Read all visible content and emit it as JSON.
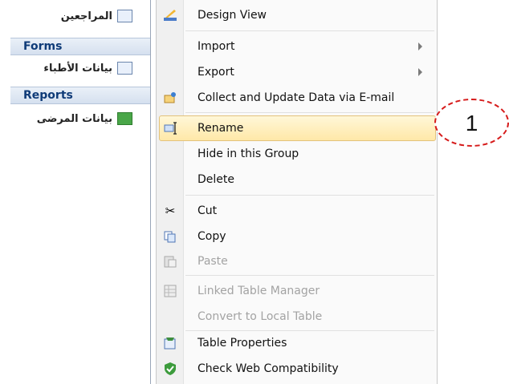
{
  "nav": {
    "top_item": "المراجعين",
    "forms_header": "Forms",
    "forms_item": "بيانات الأطباء",
    "reports_header": "Reports",
    "reports_item": "بيانات المرضى"
  },
  "menu": {
    "items": [
      {
        "label": "Design View",
        "icon": "design-view-icon",
        "disabled": false
      },
      {
        "label": "Import",
        "icon": "",
        "submenu": true,
        "disabled": false
      },
      {
        "label": "Export",
        "icon": "",
        "submenu": true,
        "disabled": false
      },
      {
        "label": "Collect and Update Data via E-mail",
        "icon": "collect-data-icon",
        "disabled": false
      },
      {
        "label": "Rename",
        "icon": "rename-icon",
        "disabled": false,
        "highlighted": true
      },
      {
        "label": "Hide in this Group",
        "icon": "",
        "disabled": false
      },
      {
        "label": "Delete",
        "icon": "",
        "disabled": false
      },
      {
        "label": "Cut",
        "icon": "scissors-icon",
        "disabled": false
      },
      {
        "label": "Copy",
        "icon": "copy-icon",
        "disabled": false
      },
      {
        "label": "Paste",
        "icon": "paste-icon",
        "disabled": true
      },
      {
        "label": "Linked Table Manager",
        "icon": "linked-table-icon",
        "disabled": true
      },
      {
        "label": "Convert to Local Table",
        "icon": "",
        "disabled": true
      },
      {
        "label": "Table Properties",
        "icon": "table-properties-icon",
        "disabled": false
      },
      {
        "label": "Check Web Compatibility",
        "icon": "web-compat-icon",
        "disabled": false
      }
    ]
  },
  "callout": {
    "number": "1"
  },
  "colors": {
    "highlight": "#ffe8a8",
    "callout_border": "#d61b1b",
    "nav_header_text": "#0f3b78"
  }
}
